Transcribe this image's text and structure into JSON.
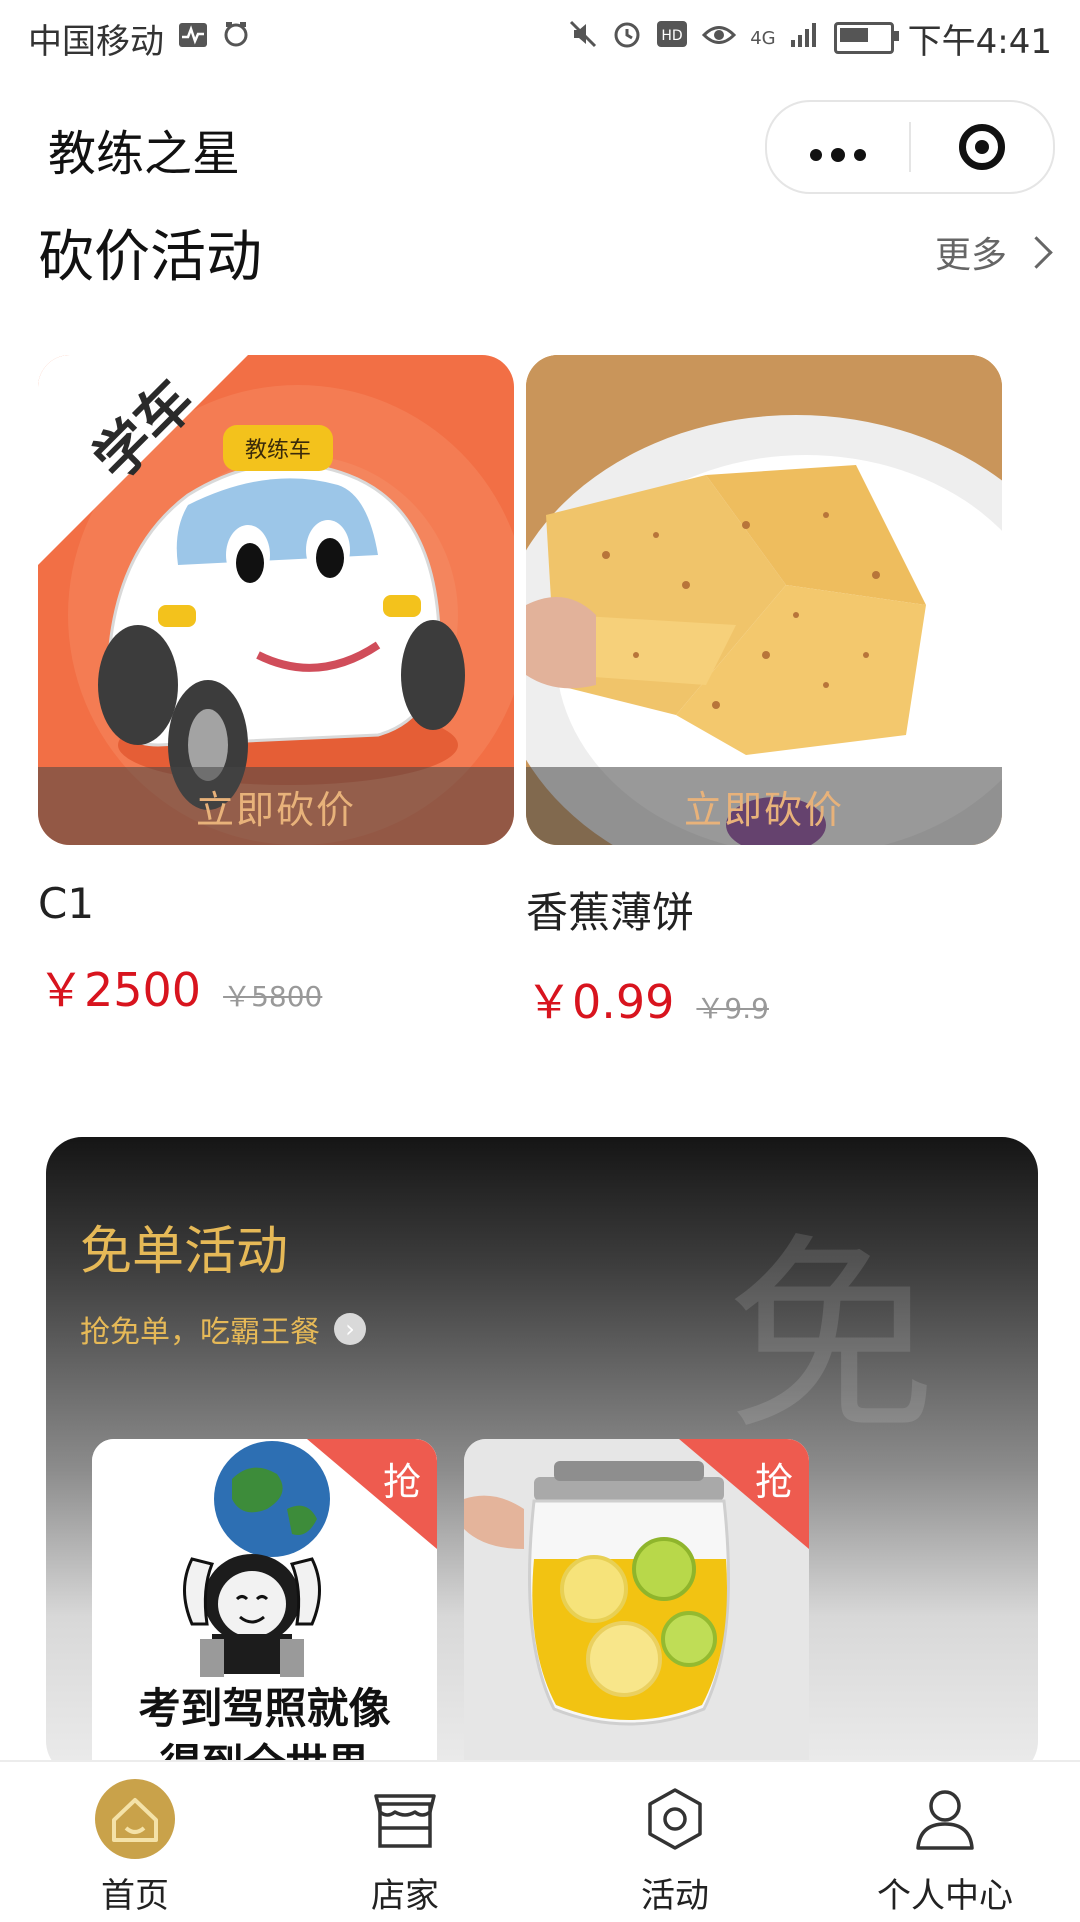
{
  "status_bar": {
    "carrier": "中国移动",
    "time": "下午4:41",
    "network": "4G"
  },
  "app": {
    "title": "教练之星"
  },
  "bargain": {
    "title": "砍价活动",
    "more": "更多",
    "items": [
      {
        "name": "C1",
        "price": "￥2500",
        "original_price": "￥5800",
        "action": "立即砍价",
        "badge_text": "教练车",
        "corner_text": "学车"
      },
      {
        "name": "香蕉薄饼",
        "price": "￥0.99",
        "original_price": "￥9.9",
        "action": "立即砍价"
      }
    ]
  },
  "free": {
    "title": "免单活动",
    "subtitle": "抢免单，吃霸王餐",
    "watermark": "免",
    "items": [
      {
        "tag": "抢",
        "caption_line1": "考到驾照就像",
        "caption_line2": "得到全世界"
      },
      {
        "tag": "抢"
      }
    ]
  },
  "tabs": [
    {
      "label": "首页",
      "icon": "home-icon",
      "active": true
    },
    {
      "label": "店家",
      "icon": "store-icon"
    },
    {
      "label": "活动",
      "icon": "activity-icon"
    },
    {
      "label": "个人中心",
      "icon": "user-icon"
    }
  ],
  "colors": {
    "price_red": "#d8141e",
    "gold": "#e6b957",
    "grab_red": "#ee5b4f",
    "car_orange": "#f26f45"
  }
}
